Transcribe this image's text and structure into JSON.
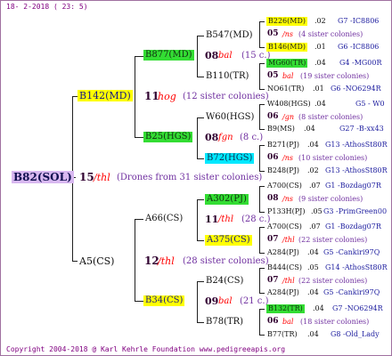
{
  "header": "18- 2-2018 ( 23: 5)",
  "footer": "Copyright 2004-2018 @ Karl Kehrle Foundation   www.pedigreeapis.org",
  "root": {
    "name": "B82(SOL)",
    "num": "15",
    "origin": "/thl",
    "note": "(Drones from 31 sister colonies)"
  },
  "gen1": {
    "dam": {
      "name": "B142(MD)",
      "num": "11",
      "origin": "hog",
      "note": "(12 sister colonies)"
    },
    "sire": {
      "name": "A5(CS)",
      "num": "12",
      "origin": "/thl",
      "note": "(28 sister colonies)"
    }
  },
  "gen2": {
    "b877": {
      "name": "B877(MD)",
      "num": "08",
      "origin": "bal",
      "note": "(15 c.)"
    },
    "b25": {
      "name": "B25(HGS)",
      "num": "08",
      "origin": "fgn",
      "note": "(8 c.)"
    },
    "a66": {
      "name": "A66(CS)",
      "num": "11",
      "origin": "/thl",
      "note": "(28 c.)"
    },
    "b34": {
      "name": "B34(CS)",
      "num": "09",
      "origin": "bal",
      "note": "(21 c.)"
    }
  },
  "gen3": {
    "b547": "B547(MD)",
    "b110": "B110(TR)",
    "w60": "W60(HGS)",
    "b72": "B72(HGS)",
    "a302": "A302(PJ)",
    "a375": "A375(CS)",
    "b24": "B24(CS)",
    "b78": "B78(TR)"
  },
  "gen4": [
    {
      "name": "B226(MD)",
      "num": ".02",
      "right": "G7 -IC8806"
    },
    {
      "num": "05",
      "origin": "/ns",
      "note": "(4 sister colonies)"
    },
    {
      "name": "B146(MD)",
      "num": ".01",
      "right": "G6 -IC8806"
    },
    {
      "name": "MG60(TR)",
      "num": ".04",
      "right": "G4 -MG00R"
    },
    {
      "num": "05",
      "origin": "bal",
      "note": "(19 sister colonies)"
    },
    {
      "name": "NO61(TR)",
      "num": ".01",
      "right": "G6 -NO6294R"
    },
    {
      "name": "W408(HGS)",
      "num": ".04",
      "right": "G5 - W0"
    },
    {
      "num": "06",
      "origin": "/gn",
      "note": "(8 sister colonies)"
    },
    {
      "name": "B9(MS)",
      "num": ".04",
      "right": "G27 -B-xx43"
    },
    {
      "name": "B271(PJ)",
      "num": ".04",
      "right": "G13 -AthosSt80R"
    },
    {
      "num": "06",
      "origin": "/ns",
      "note": "(10 sister colonies)"
    },
    {
      "name": "B248(PJ)",
      "num": ".02",
      "right": "G13 -AthosSt80R"
    },
    {
      "name": "A700(CS)",
      "num": ".07",
      "right": "G1 -Bozdag07R"
    },
    {
      "num": "08",
      "origin": "/ns",
      "note": "(9 sister colonies)"
    },
    {
      "name": "P133H(PJ)",
      "num": ".05",
      "right": "G3 -PrimGreen00"
    },
    {
      "name": "A700(CS)",
      "num": ".07",
      "right": "G1 -Bozdag07R"
    },
    {
      "num": "07",
      "origin": "/thl",
      "note": "(22 sister colonies)"
    },
    {
      "name": "A284(PJ)",
      "num": ".04",
      "right": "G5 -Cankiri97Q"
    },
    {
      "name": "B444(CS)",
      "num": ".05",
      "right": "G14 -AthosSt80R"
    },
    {
      "num": "07",
      "origin": "/thl",
      "note": "(22 sister colonies)"
    },
    {
      "name": "A284(PJ)",
      "num": ".04",
      "right": "G5 -Cankiri97Q"
    },
    {
      "name": "B132(TR)",
      "num": ".04",
      "right": "G7 -NO6294R"
    },
    {
      "num": "06",
      "origin": "bal",
      "note": "(18 sister colonies)"
    },
    {
      "name": "B77(TR)",
      "num": ".04",
      "right": "G8 -Old_Lady"
    }
  ]
}
